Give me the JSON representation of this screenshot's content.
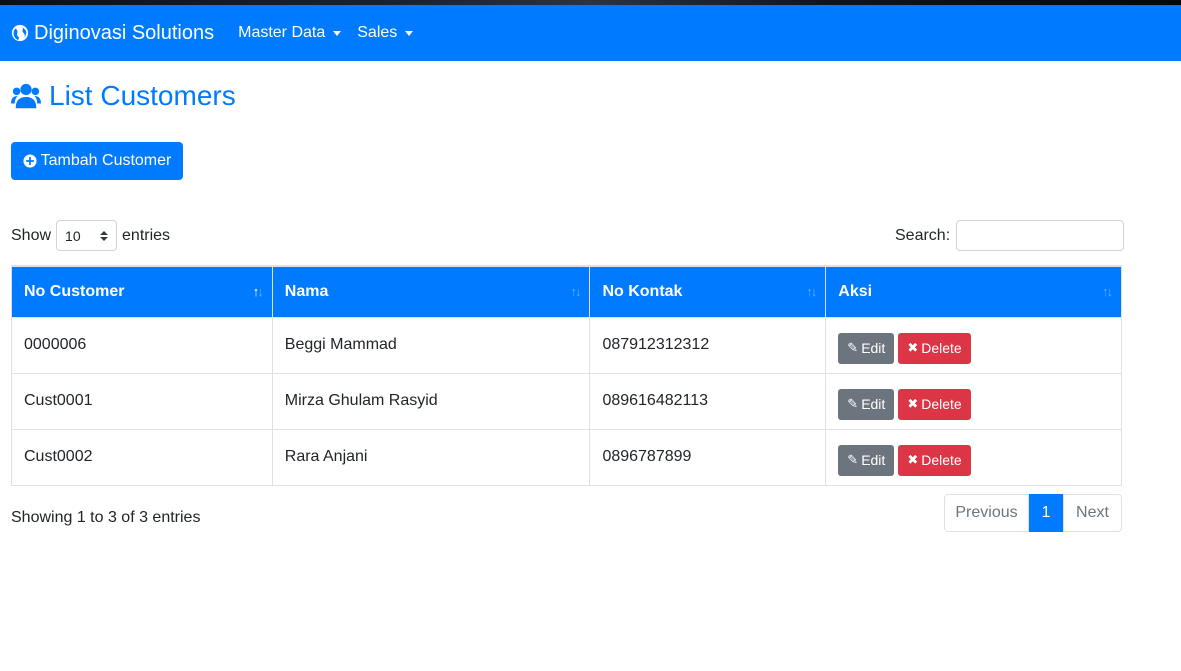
{
  "navbar": {
    "brand": "Diginovasi Solutions",
    "brand_icon": "globe-icon",
    "menus": [
      {
        "label": "Master Data"
      },
      {
        "label": "Sales"
      }
    ],
    "color": "#007bff"
  },
  "page": {
    "title": "List Customers",
    "title_icon": "users-icon",
    "add_button": "Tambah Customer",
    "add_icon": "plus-circle-icon"
  },
  "table_controls": {
    "show_label": "Show",
    "entries_label": "entries",
    "page_length": "10",
    "search_label": "Search:",
    "search_value": ""
  },
  "table": {
    "headers": [
      "No Customer",
      "Nama",
      "No Kontak",
      "Aksi"
    ],
    "rows": [
      {
        "no": "0000006",
        "nama": "Beggi Mammad",
        "kontak": "087912312312"
      },
      {
        "no": "Cust0001",
        "nama": "Mirza Ghulam Rasyid",
        "kontak": "089616482113"
      },
      {
        "no": "Cust0002",
        "nama": "Rara Anjani",
        "kontak": "0896787899"
      }
    ],
    "edit_label": "Edit",
    "delete_label": "Delete",
    "header_color": "#007bff"
  },
  "footer": {
    "info": "Showing 1 to 3 of 3 entries",
    "pagination": {
      "previous": "Previous",
      "current": "1",
      "next": "Next"
    }
  }
}
